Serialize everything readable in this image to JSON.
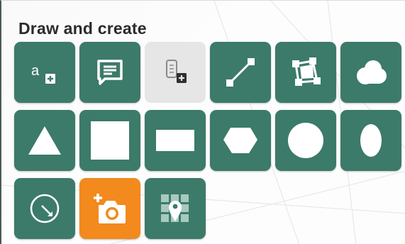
{
  "panel": {
    "title": "Draw and create"
  },
  "colors": {
    "tool_bg": "#3c7a69",
    "tool_disabled_bg": "#e6e6e6",
    "tool_active_bg": "#f28a1e",
    "icon_fill": "#ffffff"
  },
  "tools": [
    {
      "name": "text-tool",
      "icon": "text-add-icon",
      "label": "a",
      "state": "normal"
    },
    {
      "name": "callout-tool",
      "icon": "speech-bubble-icon",
      "state": "normal"
    },
    {
      "name": "note-tool",
      "icon": "note-add-icon",
      "state": "disabled"
    },
    {
      "name": "line-tool",
      "icon": "line-segment-icon",
      "state": "normal"
    },
    {
      "name": "polygon-edit-tool",
      "icon": "polygon-vertices-icon",
      "state": "normal"
    },
    {
      "name": "cloud-tool",
      "icon": "cloud-icon",
      "state": "normal"
    },
    {
      "name": "triangle-tool",
      "icon": "triangle-icon",
      "state": "normal"
    },
    {
      "name": "square-tool",
      "icon": "square-icon",
      "state": "normal"
    },
    {
      "name": "rectangle-tool",
      "icon": "rectangle-icon",
      "state": "normal"
    },
    {
      "name": "pentagon-tool",
      "icon": "pentagon-icon",
      "state": "normal"
    },
    {
      "name": "circle-tool",
      "icon": "circle-icon",
      "state": "normal"
    },
    {
      "name": "ellipse-tool",
      "icon": "ellipse-icon",
      "state": "normal"
    },
    {
      "name": "radius-circle-tool",
      "icon": "circle-radius-icon",
      "state": "normal"
    },
    {
      "name": "add-photo-tool",
      "icon": "camera-add-icon",
      "state": "active"
    },
    {
      "name": "map-grid-pin-tool",
      "icon": "grid-map-pin-icon",
      "state": "normal"
    }
  ]
}
